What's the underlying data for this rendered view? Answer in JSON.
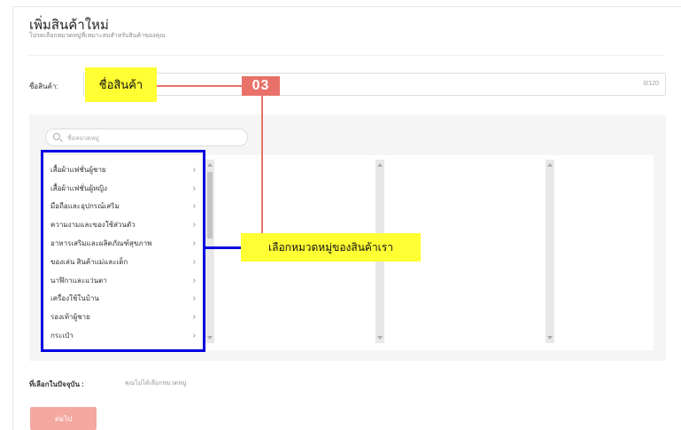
{
  "page": {
    "title": "เพิ่มสินค้าใหม่",
    "subtitle": "โปรดเลือกหมวดหมู่ที่เหมาะสมสำหรับสินค้าของคุณ"
  },
  "product_name": {
    "label": "ชื่อสินค้า:",
    "value": "",
    "counter": "0/120"
  },
  "category_search": {
    "placeholder": "ชื่อหมวดหมู่"
  },
  "categories": [
    {
      "label": "เสื้อผ้าแฟชั่นผู้ชาย"
    },
    {
      "label": "เสื้อผ้าแฟชั่นผู้หญิง"
    },
    {
      "label": "มือถือและอุปกรณ์เสริม"
    },
    {
      "label": "ความงามและของใช้ส่วนตัว"
    },
    {
      "label": "อาหารเสริมและผลิตภัณฑ์สุขภาพ"
    },
    {
      "label": "ของเล่น สินค้าแม่และเด็ก"
    },
    {
      "label": "นาฬิกาและแว่นตา"
    },
    {
      "label": "เครื่องใช้ในบ้าน"
    },
    {
      "label": "รองเท้าผู้ชาย"
    },
    {
      "label": "กระเป๋า"
    }
  ],
  "selection": {
    "label": "ที่เลือกในปัจจุบัน :",
    "value": "คุณไม่ได้เลือกหมวดหมู่"
  },
  "next_button": {
    "label": "ต่อไป"
  },
  "annotations": {
    "step_number": "03",
    "name_callout": "ชื่อสินค้า",
    "category_callout": "เลือกหมวดหมู่ของสินค้าเรา",
    "colors": {
      "callout_bg": "#ffff33",
      "step_red": "#e8716a",
      "highlight_blue": "#0000e0",
      "button_pink": "#f4a8a0"
    }
  }
}
